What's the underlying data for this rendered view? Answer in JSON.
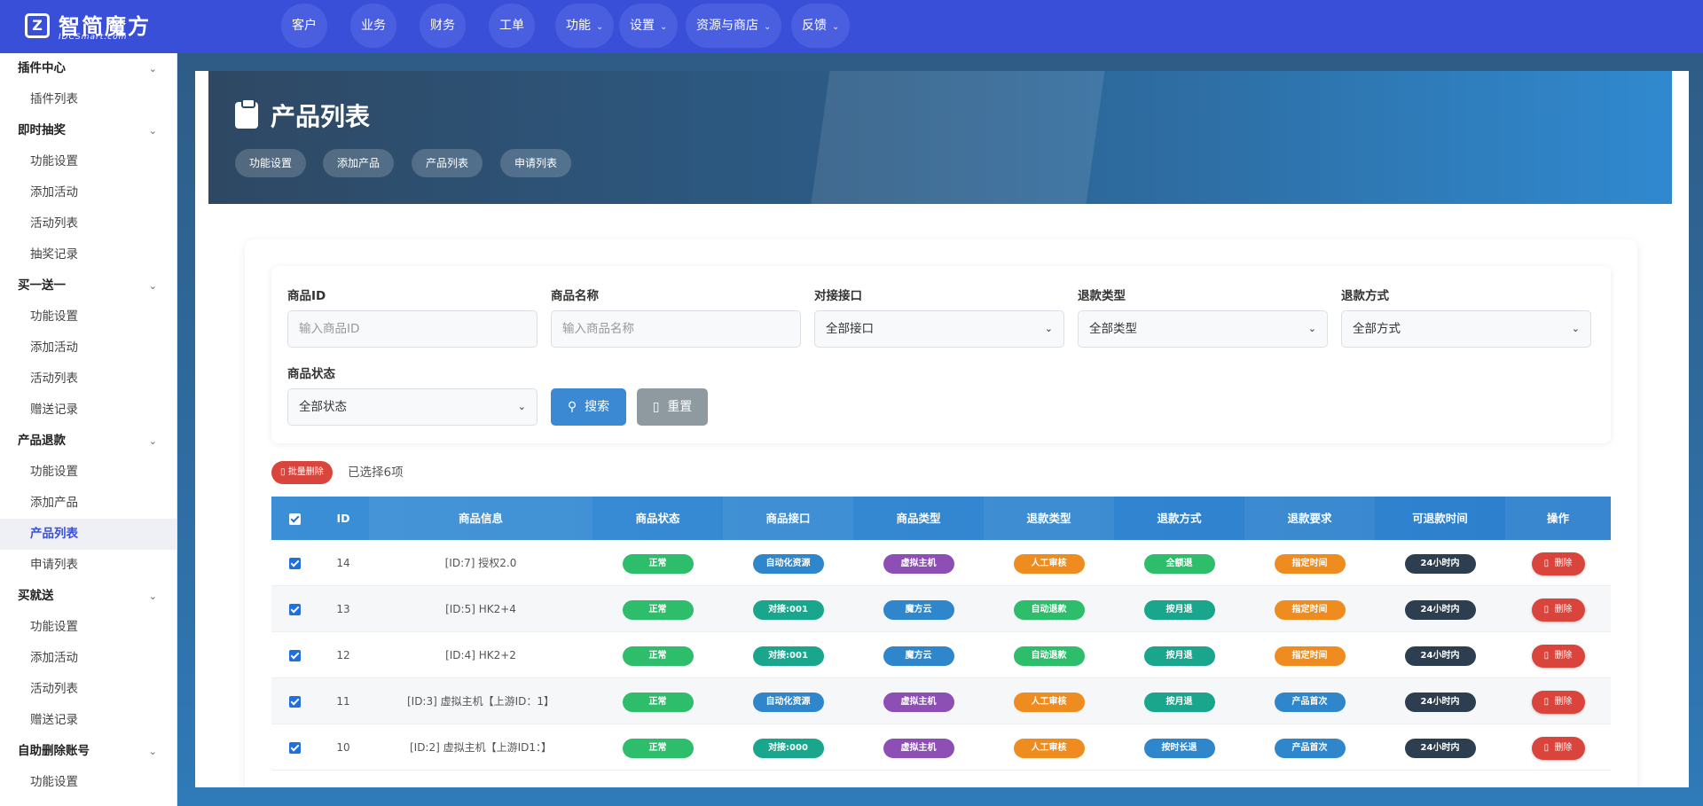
{
  "topbar": {
    "logo_name": "智简魔方",
    "logo_sub": "IDCSmart.com",
    "nav": [
      {
        "label": "客户",
        "dropdown": false
      },
      {
        "label": "业务",
        "dropdown": false
      },
      {
        "label": "财务",
        "dropdown": false
      },
      {
        "label": "工单",
        "dropdown": false
      },
      {
        "label": "功能",
        "dropdown": true
      },
      {
        "label": "设置",
        "dropdown": true
      },
      {
        "label": "资源与商店",
        "dropdown": true
      },
      {
        "label": "反馈",
        "dropdown": true
      }
    ]
  },
  "sidebar": {
    "groups": [
      {
        "label": "插件中心",
        "items": [
          "插件列表"
        ]
      },
      {
        "label": "即时抽奖",
        "items": [
          "功能设置",
          "添加活动",
          "活动列表",
          "抽奖记录"
        ]
      },
      {
        "label": "买一送一",
        "items": [
          "功能设置",
          "添加活动",
          "活动列表",
          "赠送记录"
        ]
      },
      {
        "label": "产品退款",
        "items": [
          "功能设置",
          "添加产品",
          "产品列表",
          "申请列表"
        ]
      },
      {
        "label": "买就送",
        "items": [
          "功能设置",
          "添加活动",
          "活动列表",
          "赠送记录"
        ]
      },
      {
        "label": "自助删除账号",
        "items": [
          "功能设置"
        ]
      }
    ],
    "active": "产品列表"
  },
  "hero": {
    "title": "产品列表",
    "tabs": [
      "功能设置",
      "添加产品",
      "产品列表",
      "申请列表"
    ]
  },
  "filters": {
    "product_id": {
      "label": "商品ID",
      "placeholder": "输入商品ID"
    },
    "product_name": {
      "label": "商品名称",
      "placeholder": "输入商品名称"
    },
    "interface": {
      "label": "对接接口",
      "value": "全部接口"
    },
    "refund_type": {
      "label": "退款类型",
      "value": "全部类型"
    },
    "refund_method": {
      "label": "退款方式",
      "value": "全部方式"
    },
    "status": {
      "label": "商品状态",
      "value": "全部状态"
    },
    "search_label": "搜索",
    "reset_label": "重置"
  },
  "bulk": {
    "delete_label": "批量删除",
    "selected_text": "已选择6项"
  },
  "colors": {
    "green": "#2ebd6b",
    "teal": "#19a68c",
    "blue": "#2f86cb",
    "purple": "#8e4fb5",
    "orange": "#ef8c1f",
    "dark": "#2c3e50",
    "red": "#d9453c"
  },
  "table": {
    "headers": [
      "ID",
      "商品信息",
      "商品状态",
      "商品接口",
      "商品类型",
      "退款类型",
      "退款方式",
      "退款要求",
      "可退款时间",
      "操作"
    ],
    "rows": [
      {
        "id": "14",
        "info": "[ID:7] 授权2.0",
        "status": "正常",
        "iface": "自动化资源",
        "iface_color": "blue",
        "ptype": "虚拟主机",
        "ptype_color": "purple",
        "rtype": "人工审核",
        "rtype_color": "orange",
        "rmethod": "全额退",
        "rmethod_color": "green",
        "req": "指定时间",
        "req_color": "orange",
        "time": "24小时内",
        "op": "删除"
      },
      {
        "id": "13",
        "info": "[ID:5] HK2+4",
        "status": "正常",
        "iface": "对接:001",
        "iface_color": "teal",
        "ptype": "魔方云",
        "ptype_color": "blue",
        "rtype": "自动退款",
        "rtype_color": "green",
        "rmethod": "按月退",
        "rmethod_color": "teal",
        "req": "指定时间",
        "req_color": "orange",
        "time": "24小时内",
        "op": "删除"
      },
      {
        "id": "12",
        "info": "[ID:4] HK2+2",
        "status": "正常",
        "iface": "对接:001",
        "iface_color": "teal",
        "ptype": "魔方云",
        "ptype_color": "blue",
        "rtype": "自动退款",
        "rtype_color": "green",
        "rmethod": "按月退",
        "rmethod_color": "teal",
        "req": "指定时间",
        "req_color": "orange",
        "time": "24小时内",
        "op": "删除"
      },
      {
        "id": "11",
        "info": "[ID:3] 虚拟主机【上游ID：1】",
        "status": "正常",
        "iface": "自动化资源",
        "iface_color": "blue",
        "ptype": "虚拟主机",
        "ptype_color": "purple",
        "rtype": "人工审核",
        "rtype_color": "orange",
        "rmethod": "按月退",
        "rmethod_color": "teal",
        "req": "产品首次",
        "req_color": "blue",
        "time": "24小时内",
        "op": "删除"
      },
      {
        "id": "10",
        "info": "[ID:2] 虚拟主机【上游ID1：】",
        "status": "正常",
        "iface": "对接:000",
        "iface_color": "teal",
        "ptype": "虚拟主机",
        "ptype_color": "purple",
        "rtype": "人工审核",
        "rtype_color": "orange",
        "rmethod": "按时长退",
        "rmethod_color": "blue",
        "req": "产品首次",
        "req_color": "blue",
        "time": "24小时内",
        "op": "删除"
      }
    ]
  }
}
